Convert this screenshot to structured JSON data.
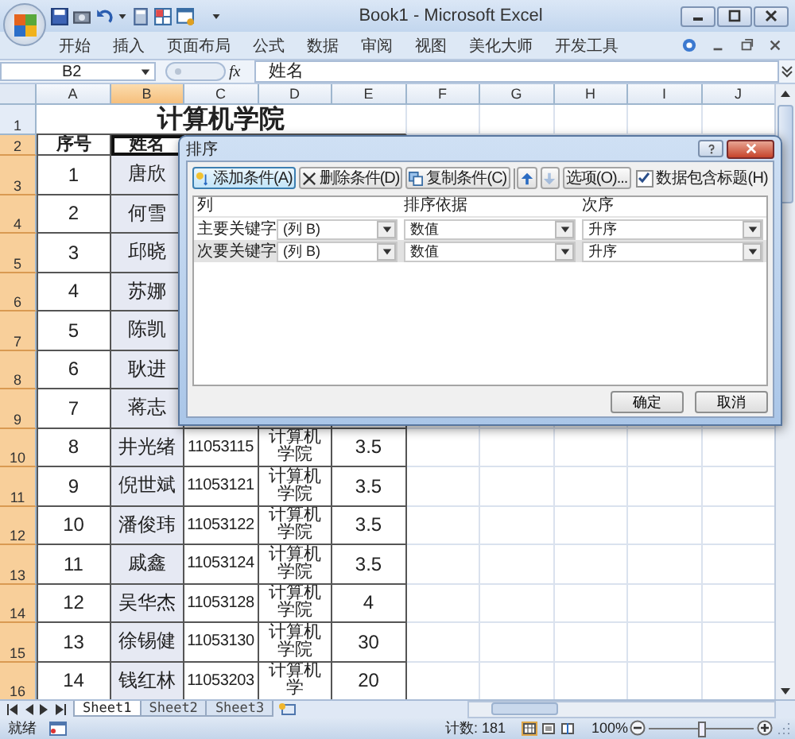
{
  "window": {
    "title": "Book1 - Microsoft Excel"
  },
  "ribbon_tabs": [
    "开始",
    "插入",
    "页面布局",
    "公式",
    "数据",
    "审阅",
    "视图",
    "美化大师",
    "开发工具"
  ],
  "formula_bar": {
    "name_box": "B2",
    "function_label": "fx",
    "value": "姓名"
  },
  "columns": [
    {
      "label": "A",
      "selected": false
    },
    {
      "label": "B",
      "selected": true
    },
    {
      "label": "C",
      "selected": false
    },
    {
      "label": "D",
      "selected": false
    },
    {
      "label": "E",
      "selected": false
    },
    {
      "label": "F",
      "selected": false
    },
    {
      "label": "G",
      "selected": false
    },
    {
      "label": "H",
      "selected": false
    },
    {
      "label": "I",
      "selected": false
    },
    {
      "label": "J",
      "selected": false
    }
  ],
  "rows": [
    {
      "label": "1",
      "selected": false,
      "title": "计算机学院"
    },
    {
      "label": "2",
      "selected": true,
      "col_a": "序号",
      "col_b": "姓名"
    },
    {
      "label": "3",
      "selected": true,
      "col_a": "1",
      "col_b": "唐欣"
    },
    {
      "label": "4",
      "selected": true,
      "col_a": "2",
      "col_b": "何雪"
    },
    {
      "label": "5",
      "selected": true,
      "col_a": "3",
      "col_b": "邱晓"
    },
    {
      "label": "6",
      "selected": true,
      "col_a": "4",
      "col_b": "苏娜"
    },
    {
      "label": "7",
      "selected": true,
      "col_a": "5",
      "col_b": "陈凯"
    },
    {
      "label": "8",
      "selected": true,
      "col_a": "6",
      "col_b": "耿进"
    },
    {
      "label": "9",
      "selected": true,
      "col_a": "7",
      "col_b": "蒋志"
    },
    {
      "label": "10",
      "selected": true,
      "col_a": "8",
      "col_b": "井光绪",
      "col_c": "11053115",
      "col_d": "计算机学院",
      "col_e": "3.5"
    },
    {
      "label": "11",
      "selected": true,
      "col_a": "9",
      "col_b": "倪世斌",
      "col_c": "11053121",
      "col_d": "计算机学院",
      "col_e": "3.5"
    },
    {
      "label": "12",
      "selected": true,
      "col_a": "10",
      "col_b": "潘俊玮",
      "col_c": "11053122",
      "col_d": "计算机学院",
      "col_e": "3.5"
    },
    {
      "label": "13",
      "selected": true,
      "col_a": "11",
      "col_b": "戚鑫",
      "col_c": "11053124",
      "col_d": "计算机学院",
      "col_e": "3.5"
    },
    {
      "label": "14",
      "selected": true,
      "col_a": "12",
      "col_b": "吴华杰",
      "col_c": "11053128",
      "col_d": "计算机学院",
      "col_e": "4"
    },
    {
      "label": "15",
      "selected": true,
      "col_a": "13",
      "col_b": "徐锡健",
      "col_c": "11053130",
      "col_d": "计算机学院",
      "col_e": "30"
    },
    {
      "label": "16",
      "selected": true,
      "col_a": "14",
      "col_b": "钱红林",
      "col_c": "11053203",
      "col_d": "计算机学",
      "col_e": "20"
    }
  ],
  "sort_dialog": {
    "title": "排序",
    "toolbar": [
      {
        "kind": "add",
        "label": "添加条件(A)",
        "focused": true,
        "disabled": false
      },
      {
        "kind": "delete",
        "label": "删除条件(D)",
        "focused": false,
        "disabled": false
      },
      {
        "kind": "copy",
        "label": "复制条件(C)",
        "focused": false,
        "disabled": false
      },
      {
        "kind": "move_up",
        "focused": false,
        "disabled": false
      },
      {
        "kind": "move_down",
        "focused": false,
        "disabled": true
      },
      {
        "kind": "options",
        "label": "选项(O)...",
        "focused": false,
        "disabled": false
      }
    ],
    "header_checkbox": {
      "label": "数据包含标题(H)",
      "checked": true
    },
    "columns": [
      "列",
      "排序依据",
      "次序"
    ],
    "levels": [
      {
        "label": "主要关键字",
        "column": "(列 B)",
        "sort_on": "数值",
        "order": "升序",
        "selected": false
      },
      {
        "label": "次要关键字",
        "column": "(列 B)",
        "sort_on": "数值",
        "order": "升序",
        "selected": true
      }
    ],
    "buttons": [
      "确定",
      "取消"
    ]
  },
  "sheet_tabs": [
    {
      "label": "Sheet1",
      "selected": true
    },
    {
      "label": "Sheet2",
      "selected": false
    },
    {
      "label": "Sheet3",
      "selected": false
    }
  ],
  "status_bar": {
    "status": "就绪",
    "count": "计数: 181",
    "zoom": "100%",
    "zoom_slider": {
      "level": 0.5
    },
    "views": [
      {
        "kind": "normal",
        "selected": true
      },
      {
        "kind": "page_layout",
        "selected": false
      },
      {
        "kind": "page_break",
        "selected": false
      }
    ]
  }
}
